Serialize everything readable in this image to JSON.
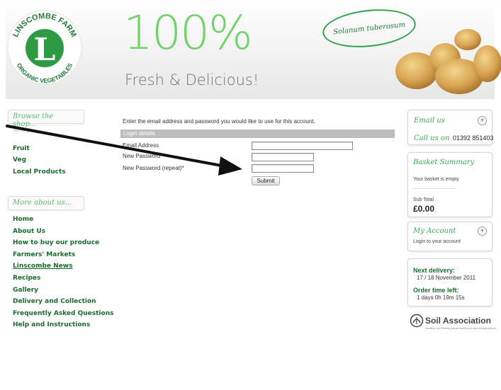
{
  "brand": {
    "logo_text_top": "LINSCOMBE FARM",
    "logo_text_bottom": "ORGANIC VEGETABLES",
    "logo_letter": "L",
    "headline": "100%",
    "tagline": "Fresh & Delicious!",
    "potato_label": "Solanum tuberosum"
  },
  "sidebar": {
    "browse_title": "Browse the shop...",
    "shop_items": [
      {
        "label": "Shop"
      },
      {
        "label": "Fruit"
      },
      {
        "label": "Veg"
      },
      {
        "label": "Local Products"
      }
    ],
    "more_title": "More about us...",
    "about_items": [
      {
        "label": "Home"
      },
      {
        "label": "About Us"
      },
      {
        "label": "How to buy our produce"
      },
      {
        "label": "Farmers' Markets"
      },
      {
        "label": "Linscombe News"
      },
      {
        "label": "Recipes"
      },
      {
        "label": "Gallery"
      },
      {
        "label": "Delivery and Collection"
      },
      {
        "label": "Frequently Asked Questions"
      },
      {
        "label": "Help and Instructions"
      }
    ]
  },
  "form": {
    "intro": "Enter the email address and password you would like to use for this account.",
    "section_title": "Login details",
    "email_label": "Email Address",
    "email_value": "",
    "password_label": "New Password",
    "password_value": "",
    "password_repeat_label": "New Password (repeat)*",
    "password_repeat_value": "",
    "submit_label": "Submit"
  },
  "contact": {
    "email_title": "Email us",
    "call_prefix": "Call us on",
    "phone": "01392 851403"
  },
  "basket": {
    "title": "Basket Summary",
    "status": "Your basket is empty",
    "subtotal_label": "Sub Total",
    "subtotal_value": "£0.00"
  },
  "account": {
    "title": "My Account",
    "login_text": "Login to your account"
  },
  "delivery": {
    "next_label": "Next delivery:",
    "next_value": "17 / 18 November 2011",
    "time_label": "Order time left:",
    "time_value": "1 days 0h 19m 15s"
  },
  "soil_association": {
    "name": "Soil Association",
    "slogan": "healthy soil healthy plants healthy people healthy planet"
  },
  "colors": {
    "accent_green": "#72d26a",
    "nav_green": "#1a6b2b",
    "script_green": "#3aa653"
  }
}
